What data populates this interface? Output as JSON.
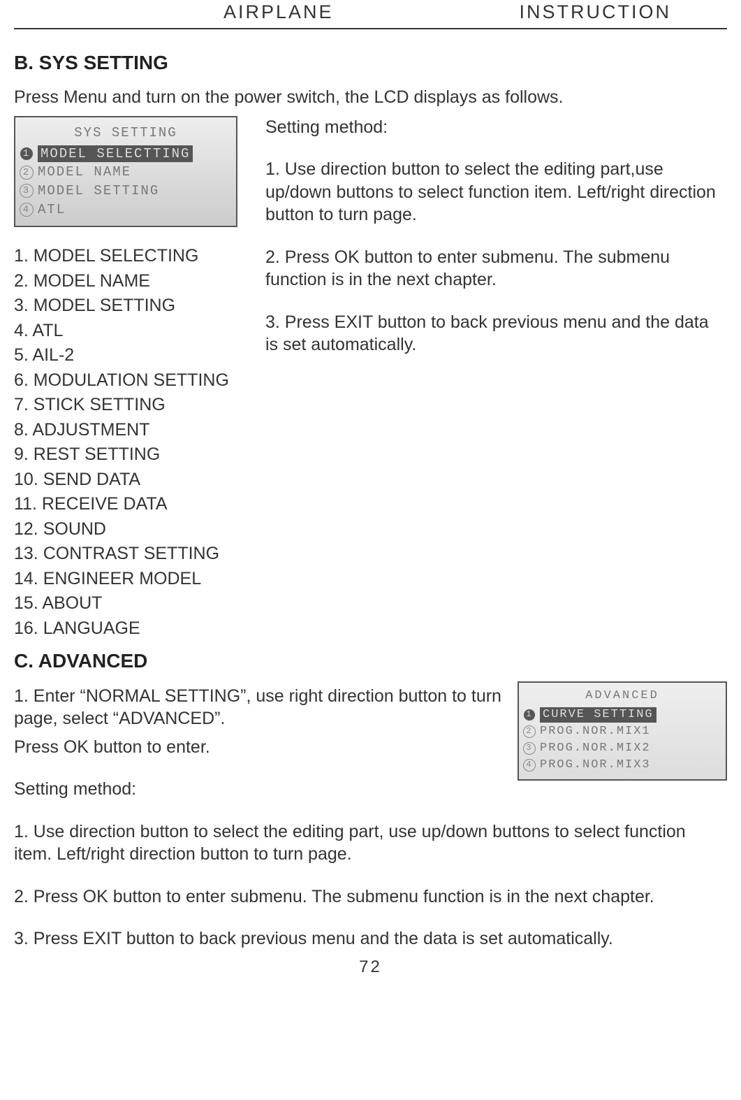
{
  "header": {
    "left": "AIRPLANE",
    "right": "INSTRUCTION"
  },
  "section_b": {
    "heading": "B. SYS SETTING",
    "intro": "Press Menu and turn on the power switch, the LCD displays as follows.",
    "lcd": {
      "title": "SYS SETTING",
      "rows": [
        {
          "n": "1",
          "t": "MODEL SELECTTING",
          "sel": true
        },
        {
          "n": "2",
          "t": "MODEL NAME",
          "sel": false
        },
        {
          "n": "3",
          "t": "MODEL SETTING",
          "sel": false
        },
        {
          "n": "4",
          "t": "ATL",
          "sel": false
        }
      ]
    },
    "list": [
      "1. MODEL SELECTING",
      "2. MODEL NAME",
      "3. MODEL SETTING",
      "4. ATL",
      "5. AIL-2",
      "6. MODULATION SETTING",
      "7. STICK SETTING",
      "8. ADJUSTMENT",
      "9. REST SETTING",
      "10. SEND DATA",
      "11. RECEIVE DATA",
      "12. SOUND",
      "13. CONTRAST SETTING",
      "14. ENGINEER MODEL",
      "15. ABOUT",
      "16. LANGUAGE"
    ],
    "method_heading": "Setting method:",
    "method": [
      "1. Use direction button to select the editing part,use up/down buttons to select function item. Left/right direction button to turn page.",
      "2. Press OK button to enter submenu. The submenu function is in the next chapter.",
      "3. Press EXIT button to back previous menu and the data is set automatically."
    ]
  },
  "section_c": {
    "heading": "C. ADVANCED",
    "intro1": "1. Enter “NORMAL SETTING”, use right direction button to turn page, select “ADVANCED”.",
    "intro2": "Press OK button to enter.",
    "lcd": {
      "title": "ADVANCED",
      "rows": [
        {
          "n": "1",
          "t": "CURVE SETTING",
          "sel": true
        },
        {
          "n": "2",
          "t": "PROG.NOR.MIX1",
          "sel": false
        },
        {
          "n": "3",
          "t": "PROG.NOR.MIX2",
          "sel": false
        },
        {
          "n": "4",
          "t": "PROG.NOR.MIX3",
          "sel": false
        }
      ]
    },
    "method_heading": "Setting method:",
    "method": [
      "1. Use direction button to select the editing part, use up/down buttons to select function item. Left/right direction button to turn page.",
      "2. Press OK button to enter submenu. The submenu function is in the next chapter.",
      "3. Press EXIT button to back previous menu and the data is set automatically."
    ]
  },
  "page_number": "72"
}
